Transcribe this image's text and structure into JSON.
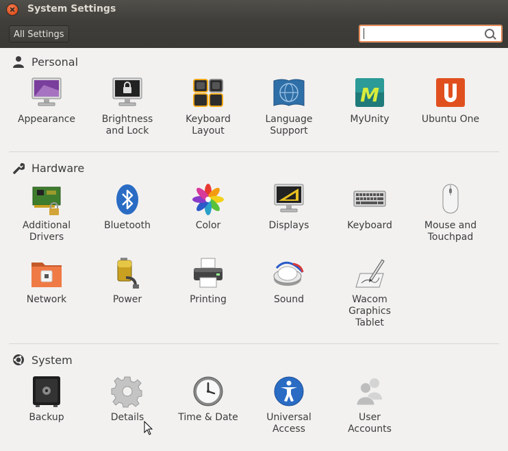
{
  "window": {
    "title": "System Settings"
  },
  "toolbar": {
    "all_settings_label": "All Settings",
    "search_value": ""
  },
  "sections": {
    "personal": {
      "title": "Personal",
      "items": [
        {
          "label": "Appearance",
          "icon": "appearance-icon"
        },
        {
          "label": "Brightness\nand Lock",
          "icon": "brightness-lock-icon"
        },
        {
          "label": "Keyboard\nLayout",
          "icon": "keyboard-layout-icon"
        },
        {
          "label": "Language\nSupport",
          "icon": "language-support-icon"
        },
        {
          "label": "MyUnity",
          "icon": "myunity-icon"
        },
        {
          "label": "Ubuntu One",
          "icon": "ubuntu-one-icon"
        }
      ]
    },
    "hardware": {
      "title": "Hardware",
      "items": [
        {
          "label": "Additional\nDrivers",
          "icon": "additional-drivers-icon"
        },
        {
          "label": "Bluetooth",
          "icon": "bluetooth-icon"
        },
        {
          "label": "Color",
          "icon": "color-icon"
        },
        {
          "label": "Displays",
          "icon": "displays-icon"
        },
        {
          "label": "Keyboard",
          "icon": "keyboard-icon"
        },
        {
          "label": "Mouse and\nTouchpad",
          "icon": "mouse-icon"
        },
        {
          "label": "Network",
          "icon": "network-icon"
        },
        {
          "label": "Power",
          "icon": "power-icon"
        },
        {
          "label": "Printing",
          "icon": "printer-icon"
        },
        {
          "label": "Sound",
          "icon": "sound-icon"
        },
        {
          "label": "Wacom\nGraphics\nTablet",
          "icon": "wacom-tablet-icon"
        }
      ]
    },
    "system": {
      "title": "System",
      "items": [
        {
          "label": "Backup",
          "icon": "backup-icon"
        },
        {
          "label": "Details",
          "icon": "details-gear-icon"
        },
        {
          "label": "Time & Date",
          "icon": "clock-icon"
        },
        {
          "label": "Universal\nAccess",
          "icon": "universal-access-icon"
        },
        {
          "label": "User\nAccounts",
          "icon": "user-accounts-icon"
        }
      ]
    }
  },
  "colors": {
    "accent": "#e05a25",
    "titlebar": "#3f3e3a",
    "background": "#f2f1f0",
    "text": "#3c3c3c"
  }
}
